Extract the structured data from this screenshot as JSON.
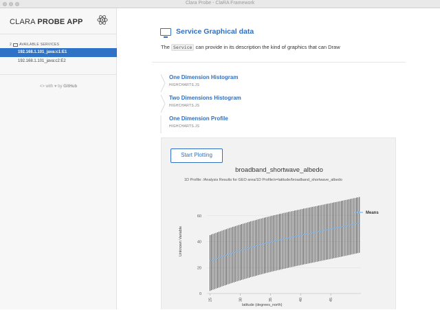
{
  "window": {
    "title": "Clara Probe - ClaRA Framework"
  },
  "sidebar": {
    "brand_light": "CLARA ",
    "brand_bold": "PROBE APP",
    "services_count": "2",
    "services_label": "AVAILABLE SERVICES",
    "services": [
      {
        "label": "192.168.1.101_java:c1:E1",
        "active": true
      },
      {
        "label": "192.168.1.101_java:c2:E2",
        "active": false
      }
    ],
    "credit_prefix": "<> with",
    "credit_by": "by",
    "credit_link": "GitHub"
  },
  "main": {
    "title": "Service Graphical data",
    "desc_pre": "The",
    "desc_code": "Service",
    "desc_post": "can provide in its description the kind of graphics that can Draw",
    "sections": [
      {
        "name": "One Dimension Histogram",
        "sub": "HIGHCHARTS.JS"
      },
      {
        "name": "Two Dimensions Histogram",
        "sub": "HIGHCHARTS.JS"
      },
      {
        "name": "One Dimension Profile",
        "sub": "HIGHCHARTS.JS"
      }
    ],
    "start_button": "Start Plotting"
  },
  "colors": {
    "accent": "#2f6fc0",
    "active_bg": "#2f73c6",
    "series": "#7cb5ec"
  },
  "chart_data": {
    "type": "line",
    "title": "broadband_shortwave_albedo",
    "subtitle": "1D Profile: /Analysis Results for GEO area/1D Profile/x=latitude/broadband_shortwave_albedo",
    "xlabel": "latitude (degrees_north)",
    "ylabel": "Unknown Variable",
    "xlim": [
      24.5,
      50
    ],
    "ylim": [
      0,
      80
    ],
    "xticks": [
      25,
      30,
      35,
      40,
      45
    ],
    "yticks": [
      0,
      20,
      40,
      60
    ],
    "legend_position": "right",
    "grid": true,
    "series": [
      {
        "name": "Means",
        "x_start": 25.0,
        "x_step": 0.25,
        "means": [
          25.0,
          25.5,
          25.9,
          26.3,
          26.8,
          27.2,
          27.6,
          28.0,
          28.5,
          28.9,
          29.3,
          29.7,
          30.1,
          30.5,
          30.9,
          31.3,
          31.6,
          32.0,
          32.4,
          32.8,
          33.1,
          33.5,
          33.8,
          34.2,
          34.5,
          34.9,
          35.2,
          35.6,
          35.9,
          36.2,
          36.5,
          36.8,
          37.2,
          37.5,
          37.8,
          38.1,
          38.4,
          38.7,
          39.0,
          39.3,
          39.6,
          39.9,
          40.2,
          40.4,
          40.7,
          41.0,
          41.3,
          41.5,
          41.8,
          42.1,
          42.3,
          42.6,
          42.9,
          43.1,
          43.4,
          43.6,
          43.9,
          44.1,
          44.4,
          44.6,
          44.9,
          45.1,
          45.4,
          45.6,
          45.8,
          46.1,
          46.3,
          46.6,
          46.8,
          47.0,
          47.3,
          47.5,
          47.8,
          48.0,
          48.2,
          48.5,
          48.7,
          49.0,
          49.2,
          49.4,
          49.7,
          49.9,
          50.2,
          50.4,
          50.6,
          50.9,
          51.1,
          51.4,
          51.6,
          51.9,
          52.1,
          52.4,
          52.6,
          52.9,
          53.1,
          53.4,
          53.6,
          53.9,
          54.1,
          54.4
        ],
        "err_down": [
          23.0,
          23.0,
          23.0,
          23.0,
          23.0,
          23.0,
          23.0,
          23.0,
          23.0,
          23.0,
          23.0,
          23.0,
          23.0,
          23.0,
          23.0,
          23.0,
          23.0,
          23.0,
          23.0,
          23.0,
          23.0,
          23.0,
          23.0,
          23.0,
          23.0,
          23.0,
          23.0,
          23.0,
          23.0,
          23.0,
          23.0,
          23.0,
          23.0,
          23.0,
          23.0,
          23.0,
          23.0,
          23.0,
          23.0,
          23.0,
          23.0,
          23.0,
          23.0,
          23.0,
          23.0,
          23.0,
          23.0,
          23.0,
          23.0,
          23.0,
          23.0,
          23.0,
          23.0,
          23.0,
          23.0,
          23.0,
          23.0,
          23.0,
          23.0,
          23.0,
          23.0,
          23.0,
          23.0,
          23.0,
          23.0,
          23.0,
          23.0,
          23.0,
          23.0,
          23.0,
          23.0,
          23.0,
          23.0,
          23.0,
          23.0,
          23.0,
          23.0,
          23.0,
          23.0,
          23.0,
          23.0,
          23.0,
          23.0,
          23.0,
          23.0,
          23.0,
          23.0,
          23.0,
          23.0,
          23.0,
          23.0,
          23.0,
          23.0,
          23.0,
          23.0,
          23.0,
          23.0,
          23.0,
          23.0,
          23.0
        ],
        "err_up": [
          20.0,
          20.0,
          20.0,
          20.0,
          20.0,
          20.0,
          20.0,
          20.0,
          20.0,
          20.0,
          20.0,
          20.0,
          20.0,
          20.0,
          20.0,
          20.0,
          20.0,
          20.0,
          20.0,
          20.0,
          20.0,
          20.0,
          20.0,
          20.0,
          20.0,
          20.0,
          20.0,
          20.0,
          20.0,
          20.0,
          20.0,
          20.0,
          20.0,
          20.0,
          20.0,
          20.0,
          20.0,
          20.0,
          20.0,
          20.0,
          20.0,
          20.0,
          20.0,
          20.0,
          20.0,
          20.0,
          20.0,
          20.0,
          20.0,
          20.0,
          20.0,
          20.0,
          20.0,
          20.0,
          20.0,
          20.0,
          20.0,
          20.0,
          20.0,
          20.0,
          20.0,
          20.0,
          20.0,
          20.0,
          20.0,
          20.0,
          20.0,
          20.0,
          20.0,
          20.0,
          20.0,
          20.0,
          20.0,
          20.0,
          20.0,
          20.0,
          20.0,
          20.0,
          20.0,
          20.0,
          20.0,
          20.0,
          20.0,
          20.0,
          20.0,
          20.0,
          20.0,
          20.0,
          20.0,
          20.0,
          20.0,
          20.0,
          20.0,
          20.0,
          20.0,
          20.0,
          20.0,
          20.0,
          20.0,
          20.0
        ]
      }
    ]
  }
}
